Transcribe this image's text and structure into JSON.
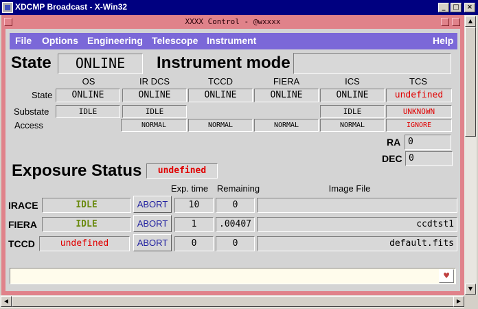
{
  "window": {
    "title": "XDCMP Broadcast - X-Win32",
    "minimize": "_",
    "maximize": "□",
    "close": "×"
  },
  "xwindow": {
    "title": "XXXX Control - @wxxxx"
  },
  "menu": {
    "file": "File",
    "options": "Options",
    "engineering": "Engineering",
    "telescope": "Telescope",
    "instrument": "Instrument",
    "help": "Help"
  },
  "state": {
    "label": "State",
    "value": "ONLINE",
    "mode_label": "Instrument mode",
    "mode_value": ""
  },
  "subsystems": {
    "headers": [
      "OS",
      "IR DCS",
      "TCCD",
      "FIERA",
      "ICS",
      "TCS"
    ],
    "row_labels": {
      "state": "State",
      "substate": "Substate",
      "access": "Access"
    },
    "state": [
      "ONLINE",
      "ONLINE",
      "ONLINE",
      "ONLINE",
      "ONLINE",
      "undefined"
    ],
    "substate": [
      "IDLE",
      "IDLE",
      "",
      "",
      "IDLE",
      "UNKNOWN"
    ],
    "access": [
      "",
      "NORMAL",
      "NORMAL",
      "NORMAL",
      "NORMAL",
      "IGNORE"
    ]
  },
  "coords": {
    "ra_label": "RA",
    "ra_value": "0",
    "dec_label": "DEC",
    "dec_value": "0"
  },
  "exposure": {
    "label": "Exposure Status",
    "status": "undefined",
    "col_exptime": "Exp. time",
    "col_remaining": "Remaining",
    "col_imagefile": "Image File",
    "abort_label": "ABORT",
    "rows": [
      {
        "name": "IRACE",
        "status": "IDLE",
        "exptime": "10",
        "remaining": "0",
        "file": ""
      },
      {
        "name": "FIERA",
        "status": "IDLE",
        "exptime": "1",
        "remaining": ".00407",
        "file": "ccdtst1"
      },
      {
        "name": "TCCD",
        "status": "undefined",
        "exptime": "0",
        "remaining": "0",
        "file": "default.fits"
      }
    ]
  },
  "message": {
    "text": ""
  },
  "colors": {
    "menubar": "#7b68d8",
    "frame": "#e0828a",
    "status_red": "#e00000",
    "status_idle": "#6a8a10"
  },
  "icons": {
    "app": "x-win32-icon",
    "dropdown": "heart-dropdown-icon"
  }
}
